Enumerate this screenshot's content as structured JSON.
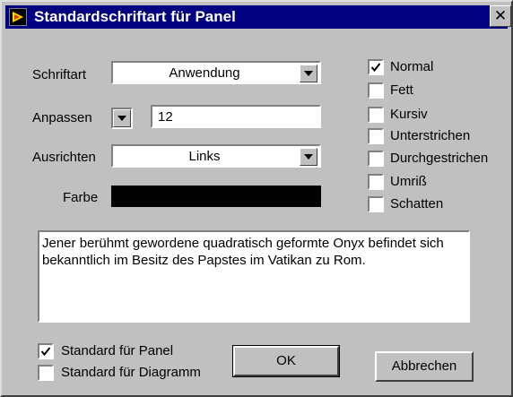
{
  "window": {
    "title": "Standardschriftart für Panel",
    "close_glyph": "✕"
  },
  "font": {
    "label": "Schriftart",
    "value": "Anwendung"
  },
  "size": {
    "label": "Anpassen",
    "value": "12"
  },
  "align": {
    "label": "Ausrichten",
    "value": "Links"
  },
  "color": {
    "label": "Farbe",
    "swatch": "#000000"
  },
  "styles": [
    {
      "label": "Normal",
      "checked": true
    },
    {
      "label": "Fett",
      "checked": false
    },
    {
      "label": "Kursiv",
      "checked": false
    },
    {
      "label": "Unterstrichen",
      "checked": false
    },
    {
      "label": "Durchgestrichen",
      "checked": false
    },
    {
      "label": "Umriß",
      "checked": false
    },
    {
      "label": "Schatten",
      "checked": false
    }
  ],
  "preview": {
    "text": "Jener berühmt gewordene quadratisch geformte Onyx befindet sich bekanntlich im Besitz des Papstes im Vatikan zu Rom."
  },
  "defaults": [
    {
      "label": "Standard für Panel",
      "checked": true
    },
    {
      "label": "Standard für Diagramm",
      "checked": false
    }
  ],
  "buttons": {
    "ok": "OK",
    "cancel": "Abbrechen"
  },
  "colors": {
    "titlebar": "#000080",
    "face": "#c0c0c0"
  }
}
